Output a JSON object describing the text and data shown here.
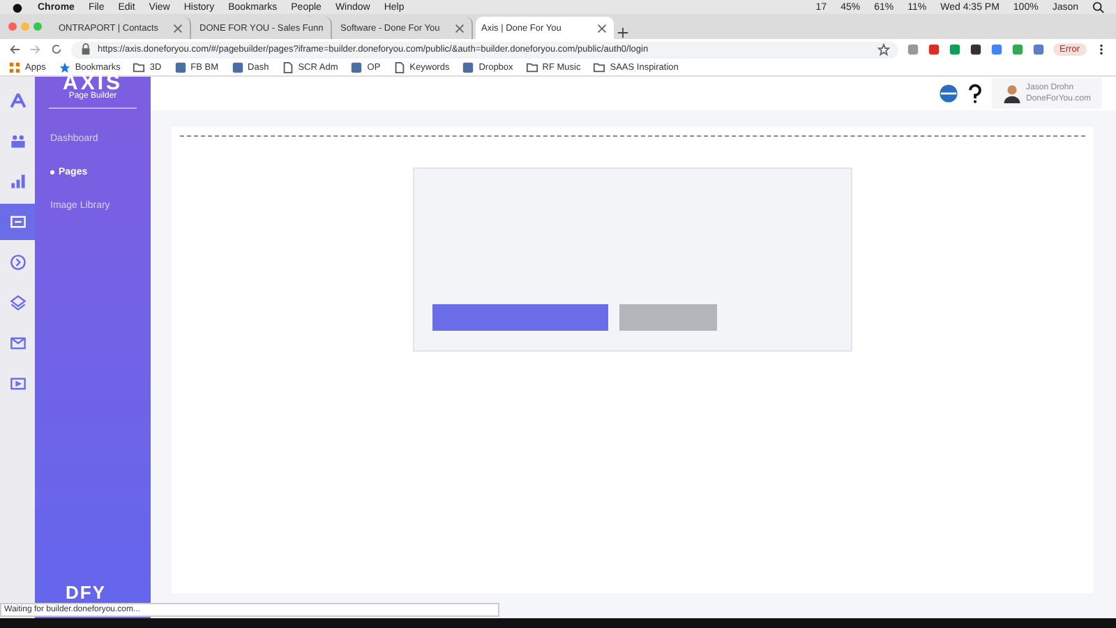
{
  "menubar": {
    "app": "Chrome",
    "menus": [
      "File",
      "Edit",
      "View",
      "History",
      "Bookmarks",
      "People",
      "Window",
      "Help"
    ],
    "status": [
      "17",
      "45%",
      "61%",
      "11%",
      "Wed 4:35 PM",
      "100%",
      "Jason"
    ]
  },
  "tabs": [
    {
      "title": "ONTRAPORT | Contacts",
      "selected": false
    },
    {
      "title": "DONE FOR YOU - Sales Funn",
      "selected": false
    },
    {
      "title": "Software - Done For You",
      "selected": false
    },
    {
      "title": "Axis | Done For You",
      "selected": true
    }
  ],
  "address_bar": {
    "url": "https://axis.doneforyou.com/#/pagebuilder/pages?iframe=builder.doneforyou.com/public/&auth=builder.doneforyou.com/public/auth0/login",
    "profile_badge": "Error"
  },
  "bookmarks": [
    {
      "label": "Apps",
      "kind": "apps"
    },
    {
      "label": "Bookmarks",
      "kind": "star"
    },
    {
      "label": "3D",
      "kind": "folder"
    },
    {
      "label": "FB BM",
      "kind": "site"
    },
    {
      "label": "Dash",
      "kind": "site"
    },
    {
      "label": "SCR Adm",
      "kind": "page"
    },
    {
      "label": "OP",
      "kind": "site"
    },
    {
      "label": "Keywords",
      "kind": "page"
    },
    {
      "label": "Dropbox",
      "kind": "site"
    },
    {
      "label": "RF Music",
      "kind": "folder"
    },
    {
      "label": "SAAS Inspiration",
      "kind": "folder"
    }
  ],
  "rail": [
    {
      "selected": false
    },
    {
      "selected": false
    },
    {
      "selected": false
    },
    {
      "selected": true
    },
    {
      "selected": false
    },
    {
      "selected": false
    },
    {
      "selected": false
    },
    {
      "selected": false
    }
  ],
  "sidebar": {
    "logo": "AXIS",
    "subtitle": "Page Builder",
    "items": [
      {
        "label": "Dashboard",
        "selected": false
      },
      {
        "label": "Pages",
        "selected": true
      },
      {
        "label": "Image Library",
        "selected": false
      }
    ],
    "footer_logo": "DFY"
  },
  "header": {
    "user_name": "Jason Drohn",
    "user_site": "DoneForYou.com"
  },
  "status_bubble": "Waiting for builder.doneforyou.com..."
}
